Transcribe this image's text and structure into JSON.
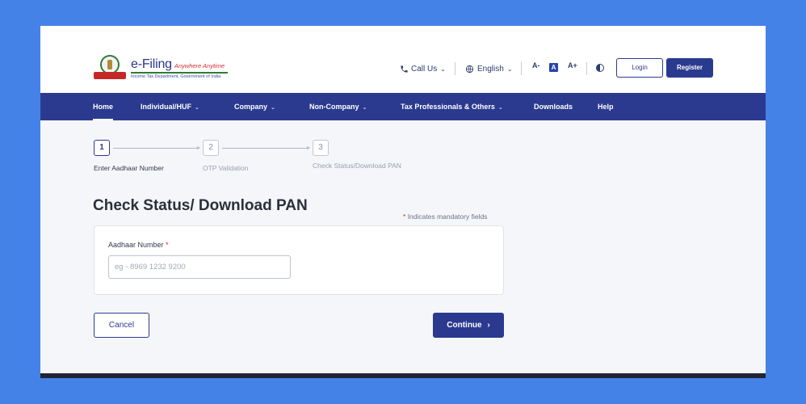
{
  "header": {
    "logo": {
      "title": "e-Filing",
      "tagline": "Anywhere Anytime",
      "subtitle": "Income Tax Department, Government of India"
    },
    "call_us": "Call Us",
    "language": "English",
    "font_controls": {
      "decrease": "A-",
      "default": "A",
      "increase": "A+"
    },
    "login_label": "Login",
    "register_label": "Register"
  },
  "nav": {
    "items": [
      {
        "label": "Home",
        "active": true,
        "has_dropdown": false
      },
      {
        "label": "Individual/HUF",
        "has_dropdown": true
      },
      {
        "label": "Company",
        "has_dropdown": true
      },
      {
        "label": "Non-Company",
        "has_dropdown": true
      },
      {
        "label": "Tax Professionals & Others",
        "has_dropdown": true
      },
      {
        "label": "Downloads",
        "has_dropdown": false
      },
      {
        "label": "Help",
        "has_dropdown": false
      }
    ]
  },
  "stepper": {
    "steps": [
      {
        "number": "1",
        "label": "Enter Aadhaar Number",
        "active": true
      },
      {
        "number": "2",
        "label": "OTP Validation",
        "active": false
      },
      {
        "number": "3",
        "label": "Check Status/Download PAN",
        "active": false
      }
    ]
  },
  "page": {
    "title": "Check Status/ Download PAN",
    "mandatory_note": "Indicates mandatory fields"
  },
  "form": {
    "aadhaar_label": "Aadhaar Number",
    "aadhaar_value": "",
    "aadhaar_placeholder": "eg - 8969 1232 9200"
  },
  "actions": {
    "cancel_label": "Cancel",
    "continue_label": "Continue"
  },
  "icons": {
    "phone": "phone-icon",
    "globe": "globe-icon",
    "contrast": "contrast-icon",
    "caret": "chevron-down-icon",
    "continue_arrow": "chevron-right-icon"
  },
  "colors": {
    "page_background": "#4582e8",
    "nav_background": "#2b3a8f",
    "primary_button": "#2b3a8f",
    "required_star": "#d32f2f"
  }
}
